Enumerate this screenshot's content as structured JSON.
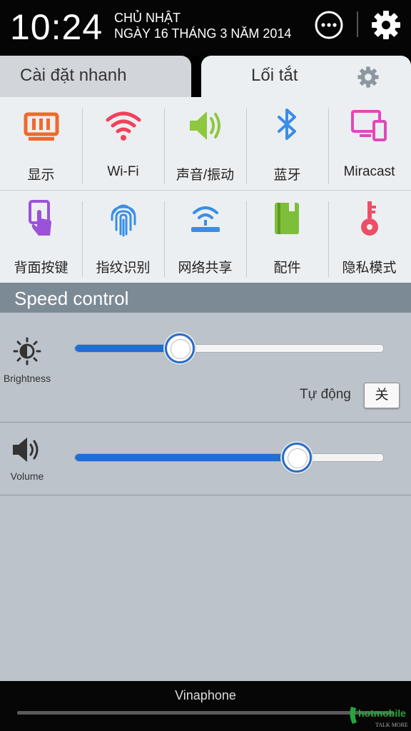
{
  "status": {
    "time": "10:24",
    "day": "CHỦ NHẬT",
    "date": "NGÀY 16 THÁNG 3 NĂM 2014"
  },
  "tabs": {
    "quick_settings": "Cài  đặt nhanh",
    "shortcuts": "Lối tắt"
  },
  "toggles_row1": [
    {
      "label": "显示",
      "icon": "display-icon",
      "color": "#ef6a2c"
    },
    {
      "label": "Wi-Fi",
      "icon": "wifi-icon",
      "color": "#f0425a"
    },
    {
      "label": "声音/振动",
      "icon": "speaker-icon",
      "color": "#8dc83e"
    },
    {
      "label": "蓝牙",
      "icon": "bluetooth-icon",
      "color": "#3a8ee6"
    },
    {
      "label": "Miracast",
      "icon": "miracast-icon",
      "color": "#e248b7"
    }
  ],
  "toggles_row2": [
    {
      "label": "背面按键",
      "icon": "back-touch-icon",
      "color": "#9b52d8"
    },
    {
      "label": "指纹识别",
      "icon": "fingerprint-icon",
      "color": "#3a8ee6"
    },
    {
      "label": "网络共享",
      "icon": "hotspot-icon",
      "color": "#3a8ee6"
    },
    {
      "label": "配件",
      "icon": "accessory-icon",
      "color": "#7dbf3a"
    },
    {
      "label": "隐私模式",
      "icon": "key-icon",
      "color": "#ef4d66"
    }
  ],
  "speed_control": {
    "title": "Speed control"
  },
  "brightness": {
    "label": "Brightness",
    "level": 0.34,
    "auto_label": "Tự  động",
    "auto_button": "关"
  },
  "volume": {
    "label": "Volume",
    "level": 0.72
  },
  "carrier": {
    "name": "Vinaphone"
  },
  "watermark": {
    "text": "hotmobile",
    "tagline": "TALK MORE"
  }
}
